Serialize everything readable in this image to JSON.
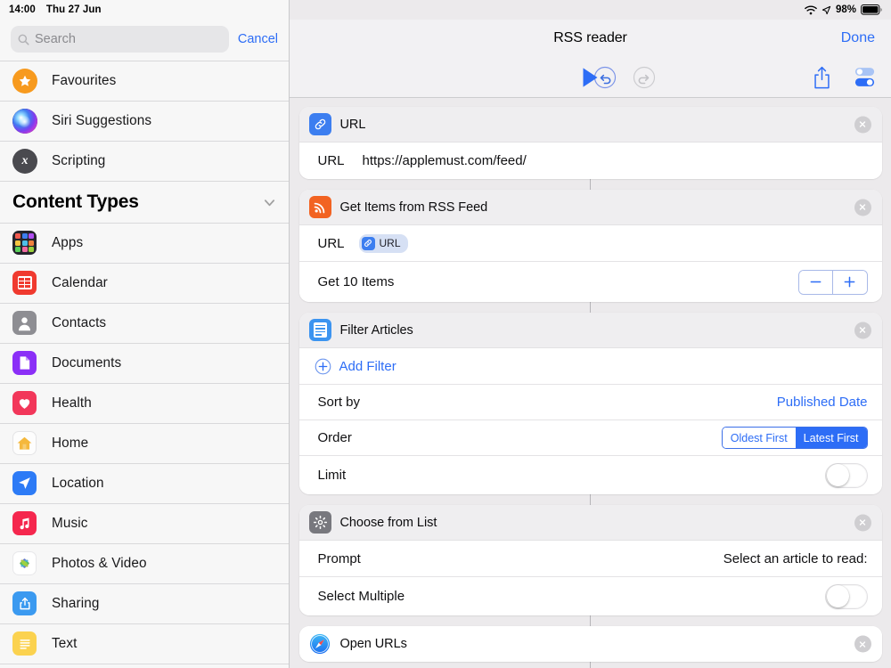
{
  "status_bar": {
    "time": "14:00",
    "date": "Thu 27 Jun",
    "battery_percent": "98%",
    "wifi_icon": "wifi-icon",
    "location_icon": "location-arrow-icon",
    "battery_icon": "battery-icon"
  },
  "sidebar": {
    "search": {
      "placeholder": "Search",
      "value": "",
      "icon": "search-icon"
    },
    "cancel_label": "Cancel",
    "top_items": [
      {
        "label": "Favourites",
        "icon": "star-icon",
        "style": "favourites"
      },
      {
        "label": "Siri Suggestions",
        "icon": "siri-icon",
        "style": "siri"
      },
      {
        "label": "Scripting",
        "icon": "scripting-x-icon",
        "style": "scripting"
      }
    ],
    "section": {
      "title": "Content Types",
      "chevron": "chevron-down-icon"
    },
    "content_types": [
      {
        "label": "Apps",
        "icon": "apps-grid-icon",
        "color": "#2b2b34"
      },
      {
        "label": "Calendar",
        "icon": "calendar-icon",
        "color": "#ff3b30"
      },
      {
        "label": "Contacts",
        "icon": "contacts-person-icon",
        "color": "#8e8e93"
      },
      {
        "label": "Documents",
        "icon": "document-page-icon",
        "color": "#8b2ff7"
      },
      {
        "label": "Health",
        "icon": "heart-icon",
        "color": "#f2375a"
      },
      {
        "label": "Home",
        "icon": "house-icon",
        "color": "#fdfdfd"
      },
      {
        "label": "Location",
        "icon": "location-arrow-icon",
        "color": "#2d7bf6"
      },
      {
        "label": "Music",
        "icon": "music-note-icon",
        "color": "#f5274e"
      },
      {
        "label": "Photos & Video",
        "icon": "photos-flower-icon",
        "color": "#ffffff"
      },
      {
        "label": "Sharing",
        "icon": "share-box-icon",
        "color": "#3b9af0"
      },
      {
        "label": "Text",
        "icon": "text-lines-icon",
        "color": "#fbd24f"
      }
    ]
  },
  "navbar": {
    "title": "RSS reader",
    "done_label": "Done"
  },
  "toolbar": {
    "undo": {
      "icon": "undo-icon",
      "enabled": true
    },
    "redo": {
      "icon": "redo-icon",
      "enabled": false
    },
    "play": {
      "icon": "play-icon"
    },
    "share": {
      "icon": "share-icon"
    },
    "settings": {
      "icon": "settings-toggles-icon"
    }
  },
  "actions": [
    {
      "name": "url-action",
      "title": "URL",
      "icon": "link-icon",
      "icon_color": "#3c7ef0",
      "close_icon": "close-icon",
      "rows": [
        {
          "type": "url",
          "label": "URL",
          "value": "https://applemust.com/feed/"
        }
      ]
    },
    {
      "name": "get-items-from-rss-feed-action",
      "title": "Get Items from RSS Feed",
      "icon": "rss-icon",
      "icon_color": "#f26322",
      "close_icon": "close-icon",
      "rows": [
        {
          "type": "token",
          "label": "URL",
          "token_label": "URL",
          "token_icon": "link-icon"
        },
        {
          "type": "stepper",
          "label": "Get 10 Items",
          "minus": "−",
          "plus": "+"
        }
      ]
    },
    {
      "name": "filter-articles-action",
      "title": "Filter Articles",
      "icon": "filter-list-icon",
      "icon_color": "#3c94f0",
      "close_icon": "close-icon",
      "rows": [
        {
          "type": "add",
          "label": "Add Filter",
          "icon": "plus-circle-icon"
        },
        {
          "type": "value",
          "label": "Sort by",
          "value": "Published Date",
          "value_style": "blue"
        },
        {
          "type": "segmented",
          "label": "Order",
          "options": [
            "Oldest First",
            "Latest First"
          ],
          "selected": "Latest First"
        },
        {
          "type": "toggle",
          "label": "Limit",
          "on": false
        }
      ]
    },
    {
      "name": "choose-from-list-action",
      "title": "Choose from List",
      "icon": "gear-icon",
      "icon_color": "#7a7a80",
      "close_icon": "close-icon",
      "rows": [
        {
          "type": "value",
          "label": "Prompt",
          "value": "Select an article to read:",
          "value_style": "plain"
        },
        {
          "type": "toggle",
          "label": "Select Multiple",
          "on": false
        }
      ]
    },
    {
      "name": "open-urls-action",
      "title": "Open URLs",
      "icon": "safari-compass-icon",
      "icon_color": "#3c9ef5",
      "close_icon": "close-icon",
      "rows": []
    }
  ],
  "colors": {
    "accent_blue": "#2d6df6",
    "card_bg": "#ffffff",
    "canvas_bg": "#eceaec",
    "sidebar_bg": "#f7f7f7"
  }
}
